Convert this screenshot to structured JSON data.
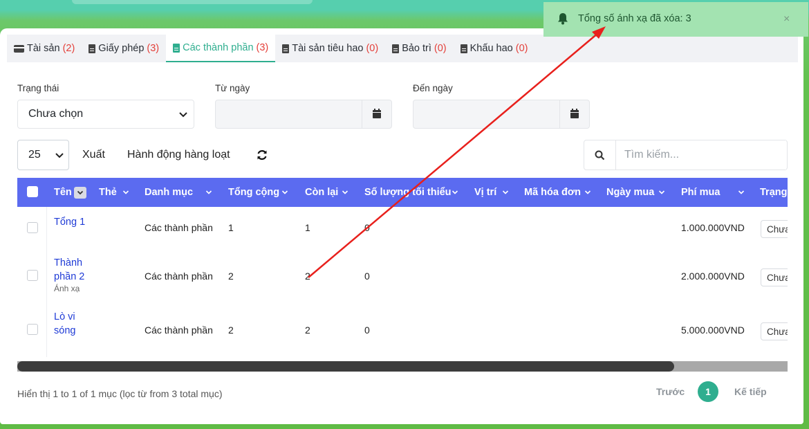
{
  "tabs": [
    {
      "label": "Tài sản",
      "count": "(2)",
      "icon": "credit-card-icon",
      "active": false
    },
    {
      "label": "Giấy phép",
      "count": "(3)",
      "icon": "file-icon",
      "active": false
    },
    {
      "label": "Các thành phần",
      "count": "(3)",
      "icon": "file-icon",
      "active": true
    },
    {
      "label": "Tài sản tiêu hao",
      "count": "(0)",
      "icon": "file-icon",
      "active": false
    },
    {
      "label": "Bảo trì",
      "count": "(0)",
      "icon": "file-icon",
      "active": false
    },
    {
      "label": "Khấu hao",
      "count": "(0)",
      "icon": "file-icon",
      "active": false
    }
  ],
  "filters": {
    "status_label": "Trạng thái",
    "status_value": "Chưa chọn",
    "from_label": "Từ ngày",
    "to_label": "Đến ngày"
  },
  "toolbar": {
    "page_size": "25",
    "export_label": "Xuất",
    "bulk_label": "Hành động hàng loạt",
    "search_placeholder": "Tìm kiếm..."
  },
  "table": {
    "columns": [
      "Tên",
      "Thẻ",
      "Danh mục",
      "Tổng cộng",
      "Còn lại",
      "Số lượng tối thiểu",
      "Vị trí",
      "Mã hóa đơn",
      "Ngày mua",
      "Phí mua",
      "Trạng"
    ],
    "rows": [
      {
        "name": "Tổng 1",
        "sub": "",
        "category": "Các thành phần",
        "total": "1",
        "remaining": "1",
        "min": "0",
        "cost": "1.000.000VND",
        "status": "Chưa"
      },
      {
        "name": "Thành phần 2",
        "sub": "Ánh xạ",
        "category": "Các thành phần",
        "total": "2",
        "remaining": "2",
        "min": "0",
        "cost": "2.000.000VND",
        "status": "Chưa"
      },
      {
        "name": "Lò vi sóng",
        "sub": "",
        "category": "Các thành phần",
        "total": "2",
        "remaining": "2",
        "min": "0",
        "cost": "5.000.000VND",
        "status": "Chưa"
      }
    ]
  },
  "footer": {
    "summary": "Hiển thị 1 to 1 of 1 mục (lọc từ from 3 total mục)",
    "prev": "Trước",
    "page": "1",
    "next": "Kế tiếp"
  },
  "toast": {
    "message": "Tổng số ánh xạ đã xóa: 3",
    "close": "×"
  },
  "colors": {
    "accent": "#2fae8f",
    "header": "#5b6bf0",
    "link": "#1f3bd6",
    "count": "#e4403a",
    "toast_bg": "#a3e3b1",
    "arrow": "#e8201c"
  }
}
